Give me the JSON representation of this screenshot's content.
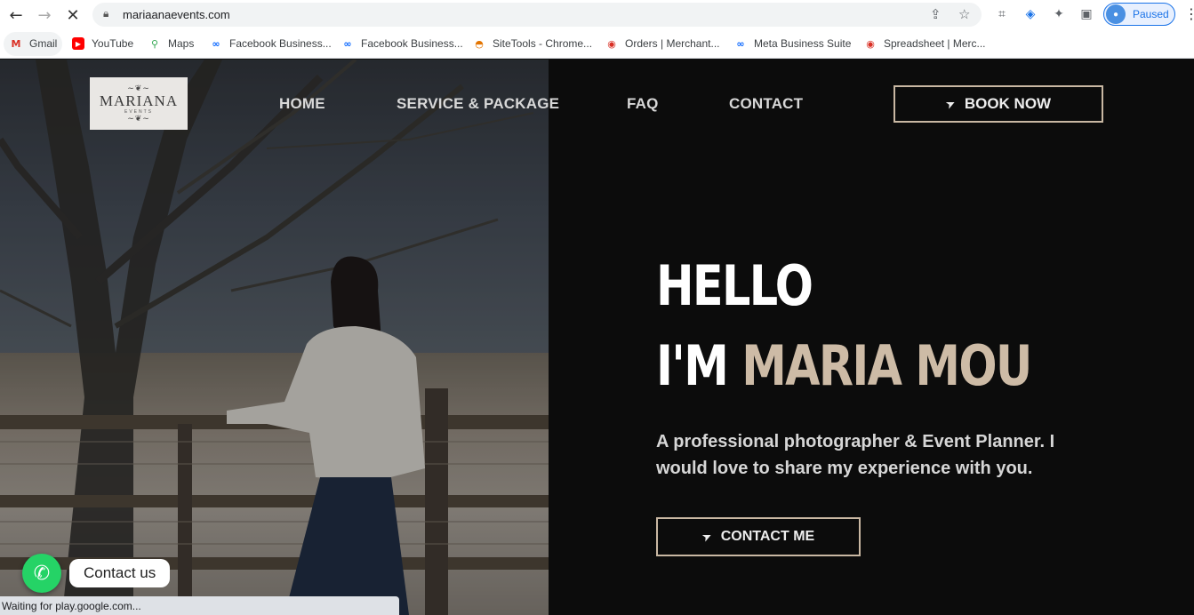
{
  "browser": {
    "url": "mariaanaevents.com",
    "profile_status": "Paused",
    "bookmarks": [
      {
        "label": "Gmail",
        "icon": "gmail-icon"
      },
      {
        "label": "YouTube",
        "icon": "youtube-icon"
      },
      {
        "label": "Maps",
        "icon": "maps-icon"
      },
      {
        "label": "Facebook Business...",
        "icon": "meta-icon"
      },
      {
        "label": "Facebook Business...",
        "icon": "meta-icon"
      },
      {
        "label": "SiteTools - Chrome...",
        "icon": "sitetools-icon"
      },
      {
        "label": "Orders | Merchant...",
        "icon": "merchant-icon"
      },
      {
        "label": "Meta Business Suite",
        "icon": "meta-icon"
      },
      {
        "label": "Spreadsheet | Merc...",
        "icon": "merchant-icon"
      }
    ],
    "status_text": "Waiting for play.google.com..."
  },
  "site": {
    "logo": {
      "text": "MARIANA",
      "sub": "EVENTS"
    },
    "nav": [
      "HOME",
      "SERVICE & PACKAGE",
      "FAQ",
      "CONTACT"
    ],
    "book_button": "BOOK NOW",
    "hero": {
      "line1": "HELLO",
      "line2_prefix": "I'M",
      "line2_name": "MARIA MOU",
      "tagline": "A professional photographer & Event Planner. I would love to share my experience with you.",
      "cta": "CONTACT ME"
    },
    "whatsapp_label": "Contact us",
    "colors": {
      "accent": "#cdbba6",
      "background": "#0c0c0c",
      "whatsapp": "#25d366"
    }
  }
}
